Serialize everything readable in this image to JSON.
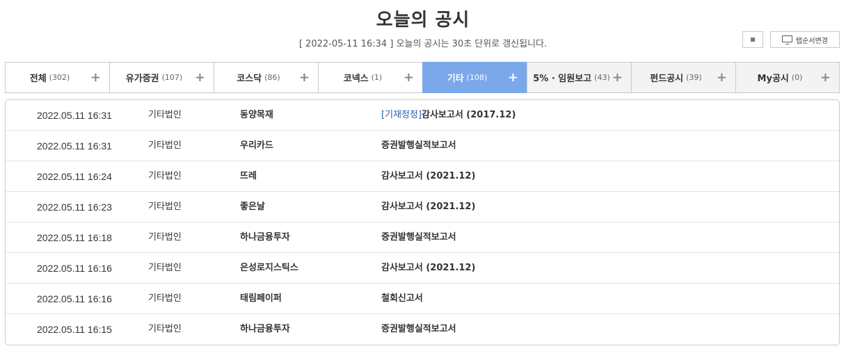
{
  "header": {
    "title": "오늘의 공시",
    "timestamp": "2022-05-11 16:34",
    "notice": "오늘의 공시는 30초 단위로 갱신됩니다."
  },
  "controls": {
    "tab_change_label": "탭순서변경"
  },
  "tabs": [
    {
      "label": "전체",
      "count": "(302)"
    },
    {
      "label": "유가증권",
      "count": "(107)"
    },
    {
      "label": "코스닥",
      "count": "(86)"
    },
    {
      "label": "코넥스",
      "count": "(1)"
    },
    {
      "label": "기타",
      "count": "(108)"
    },
    {
      "label": "5% · 임원보고",
      "count": "(43)"
    },
    {
      "label": "펀드공시",
      "count": "(39)"
    },
    {
      "label": "My공시",
      "count": "(0)"
    }
  ],
  "active_tab": "기타",
  "colors": {
    "active_tab": "#7aa8ea",
    "correction_prefix": "#2a5db0"
  },
  "disclosures": [
    {
      "time": "2022.05.11  16:31",
      "market": "기타법인",
      "company": "동양목재",
      "prefix": "[기재정정]",
      "report": "감사보고서 (2017.12)"
    },
    {
      "time": "2022.05.11  16:31",
      "market": "기타법인",
      "company": "우리카드",
      "prefix": "",
      "report": "증권발행실적보고서"
    },
    {
      "time": "2022.05.11  16:24",
      "market": "기타법인",
      "company": "뜨레",
      "prefix": "",
      "report": "감사보고서 (2021.12)"
    },
    {
      "time": "2022.05.11  16:23",
      "market": "기타법인",
      "company": "좋은날",
      "prefix": "",
      "report": "감사보고서 (2021.12)"
    },
    {
      "time": "2022.05.11  16:18",
      "market": "기타법인",
      "company": "하나금융투자",
      "prefix": "",
      "report": "증권발행실적보고서"
    },
    {
      "time": "2022.05.11  16:16",
      "market": "기타법인",
      "company": "은성로지스틱스",
      "prefix": "",
      "report": "감사보고서 (2021.12)"
    },
    {
      "time": "2022.05.11  16:16",
      "market": "기타법인",
      "company": "태림페이퍼",
      "prefix": "",
      "report": "철회신고서"
    },
    {
      "time": "2022.05.11  16:15",
      "market": "기타법인",
      "company": "하나금융투자",
      "prefix": "",
      "report": "증권발행실적보고서"
    }
  ]
}
